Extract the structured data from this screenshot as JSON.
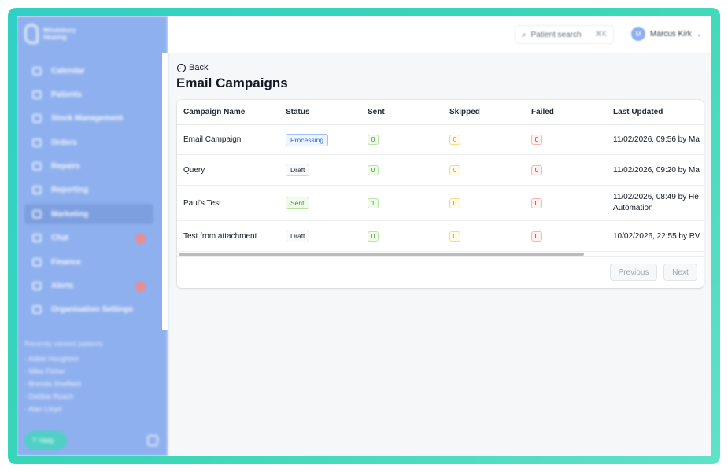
{
  "sidebar": {
    "brand": [
      "Windsbury",
      "Hearing"
    ],
    "items": [
      {
        "label": "Calendar",
        "badge": ""
      },
      {
        "label": "Patients",
        "badge": ""
      },
      {
        "label": "Stock Management",
        "badge": ""
      },
      {
        "label": "Orders",
        "badge": ""
      },
      {
        "label": "Repairs",
        "badge": ""
      },
      {
        "label": "Reporting",
        "badge": ""
      },
      {
        "label": "Marketing",
        "badge": "",
        "active": true
      },
      {
        "label": "Chat",
        "badge": "1"
      },
      {
        "label": "Finance",
        "badge": ""
      },
      {
        "label": "Alerts",
        "badge": "2"
      },
      {
        "label": "Organisation Settings",
        "badge": ""
      }
    ],
    "recent_title": "Recently viewed patients",
    "recent": [
      "- Adele Houghton",
      "- Mike Fisher",
      "- Brenda Sheffield",
      "- Debbie Roach",
      "- Alan Lloyd"
    ],
    "help_label": "Help"
  },
  "topbar": {
    "search_placeholder": "Patient search",
    "search_shortcut": "⌘K",
    "user_initials": "M",
    "user_name": "Marcus Kirk"
  },
  "page": {
    "back_label": "Back",
    "title": "Email Campaigns"
  },
  "table": {
    "columns": [
      "Campaign Name",
      "Status",
      "Sent",
      "Skipped",
      "Failed",
      "Last Updated"
    ],
    "rows": [
      {
        "name": "Email Campaign",
        "status": "Processing",
        "sent": "0",
        "skipped": "0",
        "failed": "0",
        "updated": "11/02/2026, 09:56 by Ma",
        "h": 38
      },
      {
        "name": "Query",
        "status": "Draft",
        "sent": "0",
        "skipped": "0",
        "failed": "0",
        "updated": "11/02/2026, 09:20 by Ma",
        "h": 39
      },
      {
        "name": "Paul's Test",
        "status": "Sent",
        "sent": "1",
        "skipped": "0",
        "failed": "0",
        "updated": "11/02/2026, 08:49 by He Automation",
        "h": 45
      },
      {
        "name": "Test from attachment",
        "status": "Draft",
        "sent": "0",
        "skipped": "0",
        "failed": "0",
        "updated": "10/02/2026, 22:55 by RV",
        "h": 39
      }
    ]
  },
  "pager": {
    "previous": "Previous",
    "next": "Next"
  }
}
